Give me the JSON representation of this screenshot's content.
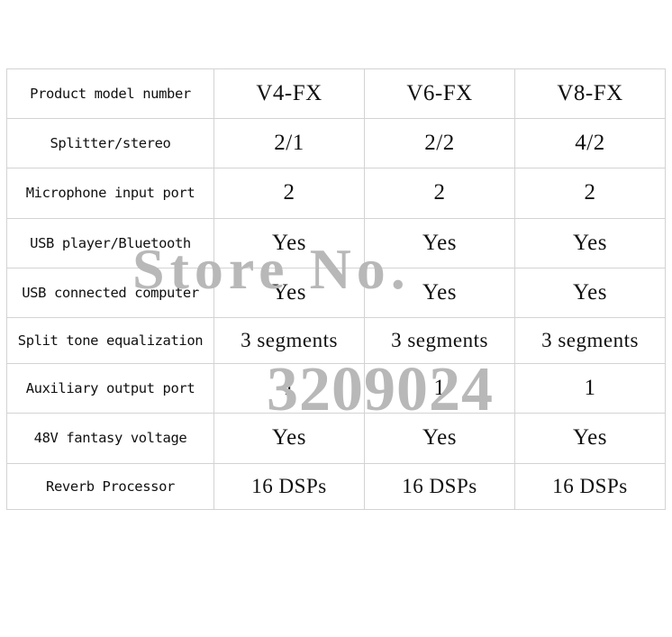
{
  "document": {
    "type": "product-specification-table",
    "background_color": "#ffffff",
    "grid_line_color": "#d3d3d3",
    "text_color": "#101010"
  },
  "watermarks": {
    "color": "#b8b8b8",
    "line1": "Store No.",
    "line2": "3209024"
  },
  "table": {
    "columns": [
      {
        "key": "label",
        "header": "Product model number"
      },
      {
        "key": "v4",
        "header": "V4-FX"
      },
      {
        "key": "v6",
        "header": "V6-FX"
      },
      {
        "key": "v8",
        "header": "V8-FX"
      }
    ],
    "rows": [
      {
        "label": "Product model number",
        "v4": "V4-FX",
        "v6": "V6-FX",
        "v8": "V8-FX"
      },
      {
        "label": "Splitter/stereo",
        "v4": "2/1",
        "v6": "2/2",
        "v8": "4/2"
      },
      {
        "label": "Microphone input port",
        "v4": "2",
        "v6": "2",
        "v8": "2"
      },
      {
        "label": "USB player/Bluetooth",
        "v4": "Yes",
        "v6": "Yes",
        "v8": "Yes"
      },
      {
        "label": "USB connected computer",
        "v4": "Yes",
        "v6": "Yes",
        "v8": "Yes"
      },
      {
        "label": "Split tone equalization",
        "v4": "3 segments",
        "v6": "3 segments",
        "v8": "3 segments"
      },
      {
        "label": "Auxiliary output port",
        "v4": "1",
        "v6": "1",
        "v8": "1"
      },
      {
        "label": "48V fantasy voltage",
        "v4": "Yes",
        "v6": "Yes",
        "v8": "Yes"
      },
      {
        "label": "Reverb Processor",
        "v4": "16 DSPs",
        "v6": "16 DSPs",
        "v8": "16 DSPs"
      }
    ]
  }
}
